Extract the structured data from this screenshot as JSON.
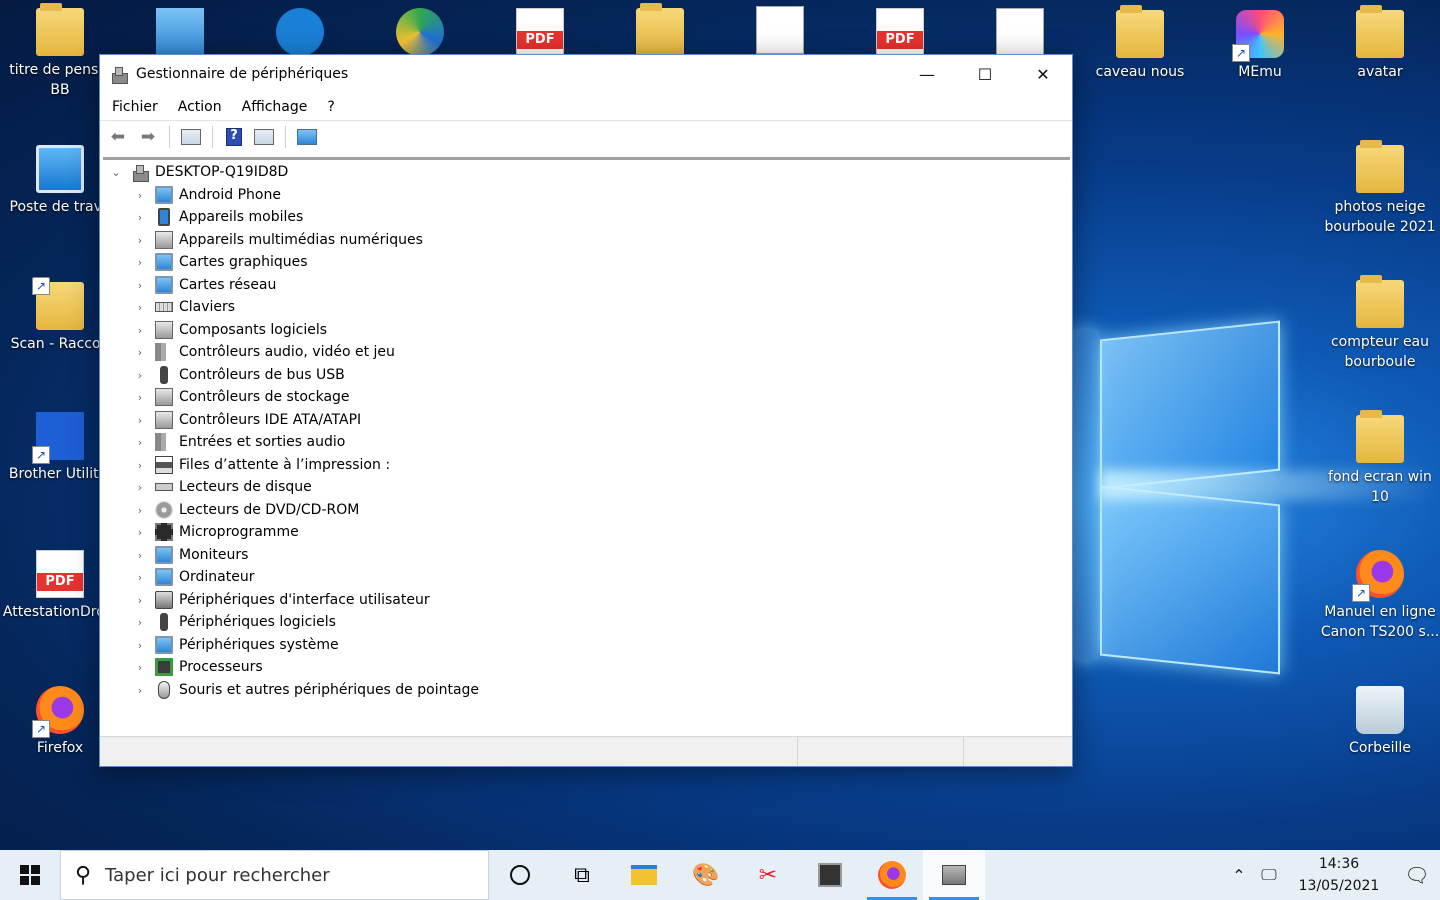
{
  "desktop": {
    "left_icons": [
      {
        "label": "titre de pensio BB"
      },
      {
        "label": "Poste de trava"
      },
      {
        "label": "Scan - Raccou"
      },
      {
        "label": "Brother Utilitie"
      },
      {
        "label": "AttestationDro jl"
      },
      {
        "label": "Firefox"
      }
    ],
    "right_icons": [
      {
        "label": "caveau nous"
      },
      {
        "label": "MEmu"
      },
      {
        "label": "avatar"
      },
      {
        "label": "photos neige bourboule 2021"
      },
      {
        "label": "compteur eau bourboule"
      },
      {
        "label": "fond ecran win 10"
      },
      {
        "label": "Manuel en ligne Canon TS200 s..."
      },
      {
        "label": "Corbeille"
      }
    ]
  },
  "window": {
    "title": "Gestionnaire de périphériques",
    "controls": {
      "minimize": "—",
      "maximize": "☐",
      "close": "✕"
    },
    "menu": [
      "Fichier",
      "Action",
      "Affichage",
      "?"
    ],
    "toolbar": {
      "back": "back-arrow-icon",
      "forward": "forward-arrow-icon",
      "properties": "properties-icon",
      "help": "?",
      "view": "view-icon",
      "scan": "scan-hardware-icon"
    },
    "tree": {
      "root": "DESKTOP-Q19ID8D",
      "items": [
        "Android Phone",
        "Appareils mobiles",
        "Appareils multimédias numériques",
        "Cartes graphiques",
        "Cartes réseau",
        "Claviers",
        "Composants logiciels",
        "Contrôleurs audio, vidéo et jeu",
        "Contrôleurs de bus USB",
        "Contrôleurs de stockage",
        "Contrôleurs IDE ATA/ATAPI",
        "Entrées et sorties audio",
        "Files d’attente à l’impression :",
        "Lecteurs de disque",
        "Lecteurs de DVD/CD-ROM",
        "Microprogramme",
        "Moniteurs",
        "Ordinateur",
        "Périphériques d'interface utilisateur",
        "Périphériques logiciels",
        "Périphériques système",
        "Processeurs",
        "Souris et autres périphériques de pointage"
      ]
    }
  },
  "taskbar": {
    "search_placeholder": "Taper ici pour rechercher",
    "time": "14:36",
    "date": "13/05/2021"
  }
}
